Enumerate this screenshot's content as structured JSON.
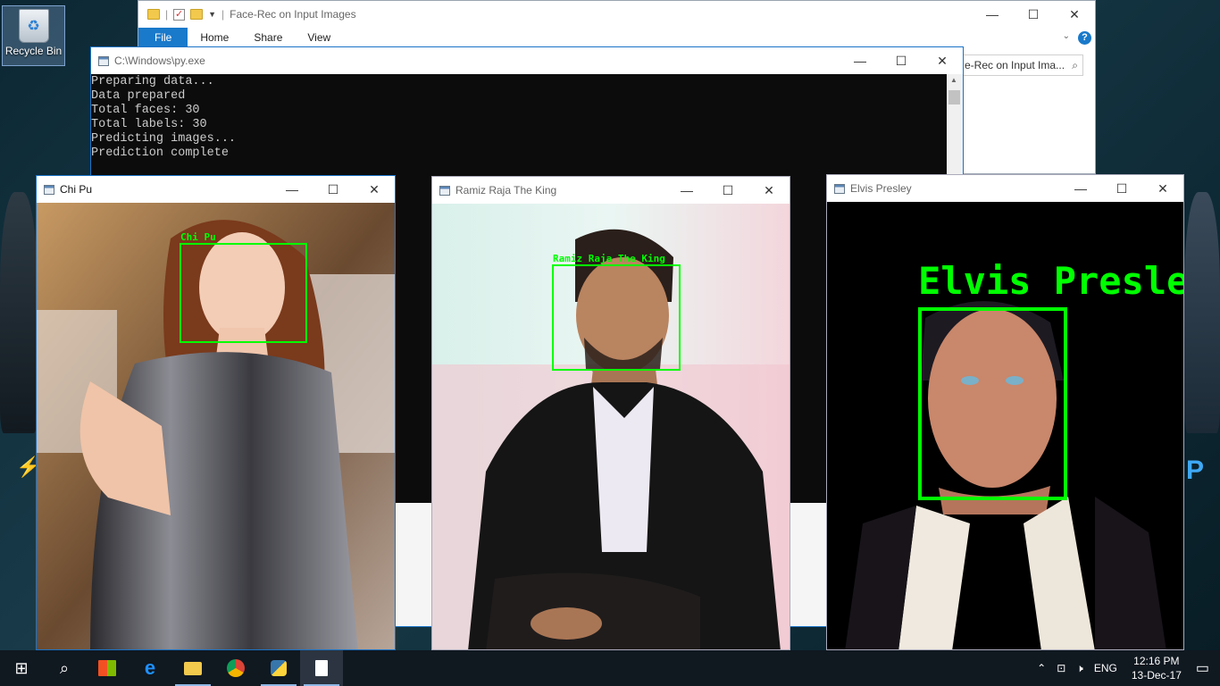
{
  "desktop": {
    "recycle_bin_label": "Recycle Bin"
  },
  "explorer": {
    "title": "Face-Rec on Input Images",
    "tabs": [
      "File",
      "Home",
      "Share",
      "View"
    ],
    "address_text": "e-Rec on Input Ima..."
  },
  "console": {
    "title": "C:\\Windows\\py.exe",
    "lines": [
      "Preparing data...",
      "Data prepared",
      "Total faces:  30",
      "Total labels:  30",
      "Predicting images...",
      "Prediction complete"
    ]
  },
  "windows": [
    {
      "title": "Chi Pu",
      "label": "Chi Pu"
    },
    {
      "title": "Ramiz Raja The King",
      "label": "Ramiz Raja The King"
    },
    {
      "title": "Elvis Presley",
      "label": "Elvis Presley"
    }
  ],
  "taskbar": {
    "icons": [
      "windows-start-icon",
      "search-icon",
      "store-icon",
      "edge-icon",
      "file-explorer-icon",
      "chrome-icon",
      "python-icon",
      "document-icon"
    ],
    "language": "ENG",
    "time": "12:16 PM",
    "date": "13-Dec-17"
  },
  "colors": {
    "detection": "#00ff00",
    "accent": "#1979ca"
  }
}
